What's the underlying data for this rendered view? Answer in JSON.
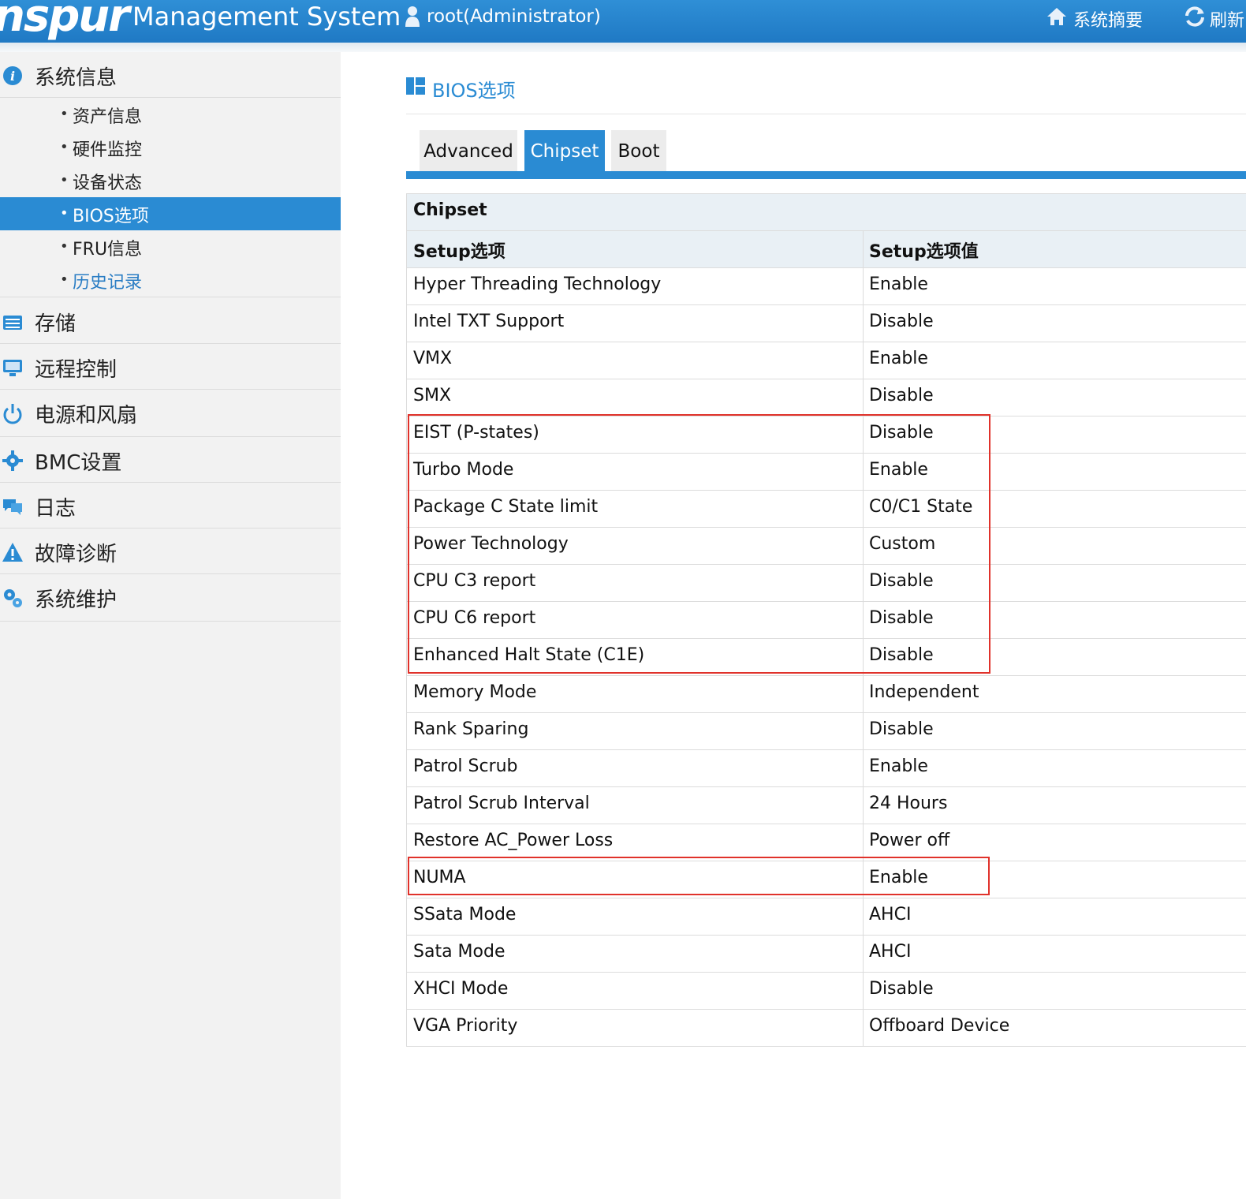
{
  "header": {
    "logo": "nspur",
    "app_title": "Management System",
    "user": "root(Administrator)",
    "home_link": "系统摘要",
    "refresh_link": "刷新"
  },
  "sidebar": {
    "sections": [
      {
        "label": "系统信息",
        "icon": "info-icon",
        "color": "#2a8bd3"
      },
      {
        "label": "存储",
        "icon": "storage-icon",
        "color": "#2a8bd3"
      },
      {
        "label": "远程控制",
        "icon": "monitor-icon",
        "color": "#2a8bd3"
      },
      {
        "label": "电源和风扇",
        "icon": "power-icon",
        "color": "#2a8bd3"
      },
      {
        "label": "BMC设置",
        "icon": "gear-icon",
        "color": "#2a8bd3"
      },
      {
        "label": "日志",
        "icon": "chat-icon",
        "color": "#2a8bd3"
      },
      {
        "label": "故障诊断",
        "icon": "warning-icon",
        "color": "#2a8bd3"
      },
      {
        "label": "系统维护",
        "icon": "gears-icon",
        "color": "#2a8bd3"
      }
    ],
    "sub_items": [
      {
        "label": "资产信息"
      },
      {
        "label": "硬件监控"
      },
      {
        "label": "设备状态"
      },
      {
        "label": "BIOS选项",
        "state": "active"
      },
      {
        "label": "FRU信息"
      },
      {
        "label": "历史记录",
        "state": "link"
      }
    ]
  },
  "main": {
    "title": "BIOS选项",
    "tabs": [
      {
        "label": "Advanced"
      },
      {
        "label": "Chipset",
        "active": true
      },
      {
        "label": "Boot"
      }
    ],
    "table": {
      "caption": "Chipset",
      "headers": [
        "Setup选项",
        "Setup选项值"
      ],
      "rows": [
        [
          "Hyper Threading Technology",
          "Enable"
        ],
        [
          "Intel TXT Support",
          "Disable"
        ],
        [
          "VMX",
          "Enable"
        ],
        [
          "SMX",
          "Disable"
        ],
        [
          "EIST (P-states)",
          "Disable"
        ],
        [
          "Turbo Mode",
          "Enable"
        ],
        [
          "Package C State limit",
          "C0/C1 State"
        ],
        [
          "Power Technology",
          "Custom"
        ],
        [
          "CPU C3 report",
          "Disable"
        ],
        [
          "CPU C6 report",
          "Disable"
        ],
        [
          "Enhanced Halt State (C1E)",
          "Disable"
        ],
        [
          "Memory Mode",
          "Independent"
        ],
        [
          "Rank Sparing",
          "Disable"
        ],
        [
          "Patrol Scrub",
          "Enable"
        ],
        [
          "Patrol Scrub Interval",
          "24 Hours"
        ],
        [
          "Restore AC_Power Loss",
          "Power off"
        ],
        [
          "NUMA",
          "Enable"
        ],
        [
          "SSata Mode",
          "AHCI"
        ],
        [
          "Sata Mode",
          "AHCI"
        ],
        [
          "XHCI Mode",
          "Disable"
        ],
        [
          "VGA Priority",
          "Offboard Device"
        ]
      ]
    },
    "highlight_color": "#e0322b"
  }
}
